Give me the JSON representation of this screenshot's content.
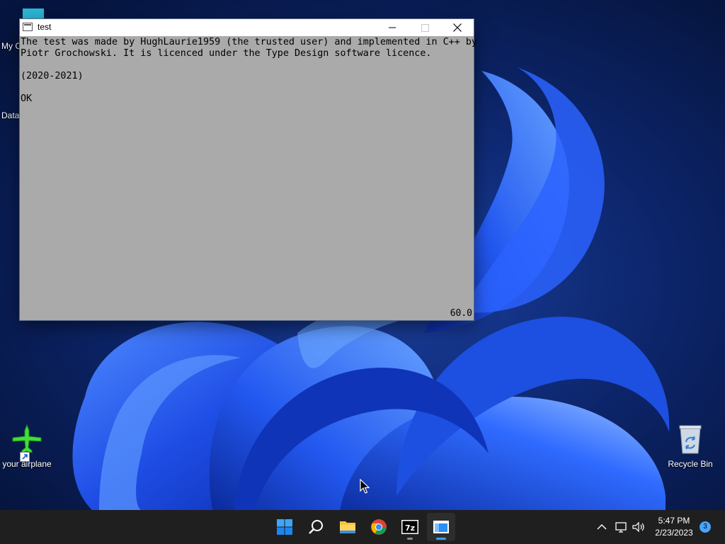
{
  "desktop": {
    "icons": [
      {
        "label": "My C",
        "icon": "computer-icon"
      },
      {
        "label": "Data",
        "icon": "data-shortcut-icon"
      },
      {
        "label": "your airplane",
        "icon": "airplane-icon"
      },
      {
        "label": "Recycle Bin",
        "icon": "recycle-bin-icon"
      }
    ]
  },
  "window": {
    "title": "test",
    "controls": {
      "minimize": "minimize-icon",
      "maximize": "maximize-icon",
      "close": "close-icon"
    },
    "lines": [
      "The test was made by HughLaurie1959 (the trusted user) and implemented in C++ by",
      "Piotr Grochowski. It is licenced under the Type Design software licence.",
      "",
      "(2020-2021)",
      "",
      "OK"
    ],
    "fps": "60.0",
    "background_color": "#aaaaaa"
  },
  "taskbar": {
    "apps": [
      {
        "name": "Start",
        "icon": "windows-start-icon"
      },
      {
        "name": "Search",
        "icon": "search-icon"
      },
      {
        "name": "File Explorer",
        "icon": "folder-icon"
      },
      {
        "name": "Google Chrome",
        "icon": "chrome-icon",
        "running": true
      },
      {
        "name": "7-Zip",
        "icon": "7zip-icon",
        "label": "7z",
        "running": true
      },
      {
        "name": "test",
        "icon": "app-window-icon",
        "active": true
      }
    ],
    "tray": {
      "chevron": "chevron-up-icon",
      "network": "network-icon",
      "volume": "volume-icon",
      "time": "5:47 PM",
      "date": "2/23/2023",
      "notifications": "3"
    }
  },
  "colors": {
    "taskbar": "#1f1f1f",
    "accent": "#3aa0ff",
    "wallpaper_dark": "#071a4a"
  }
}
